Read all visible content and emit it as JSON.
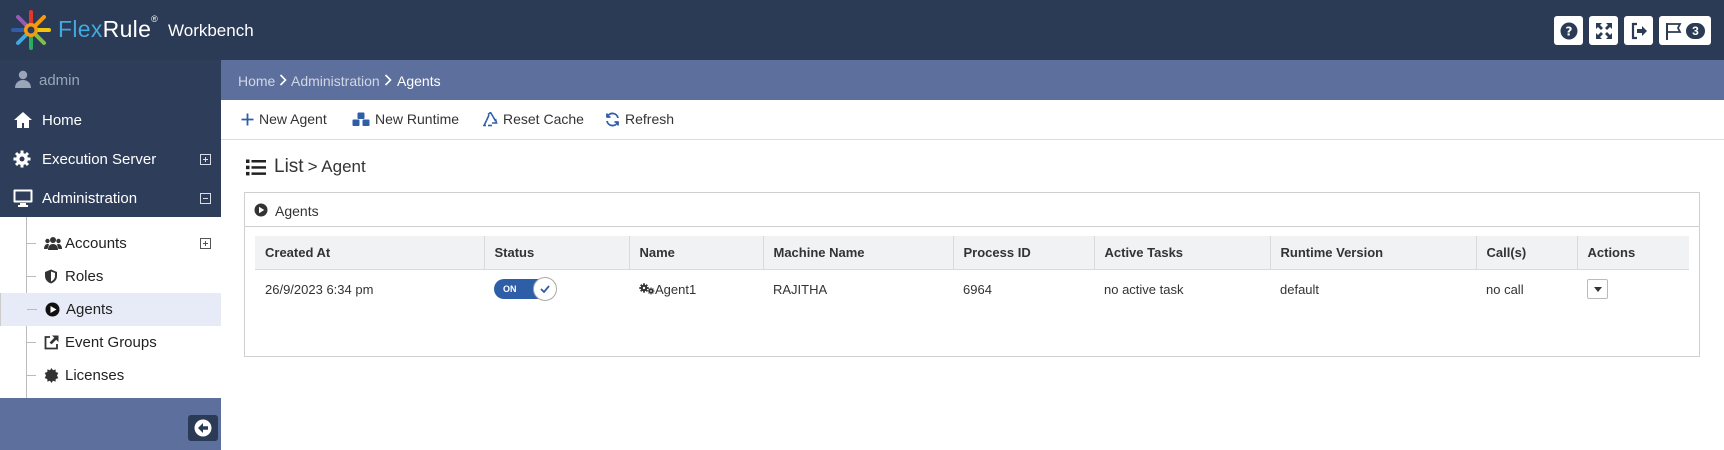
{
  "header": {
    "brand_flex": "Flex",
    "brand_rule": "Rule",
    "brand_mark": "®",
    "product": "Workbench",
    "flag_count": "3",
    "colors": {
      "bar": "#2b3a55",
      "brand_blue": "#3fa9e0"
    }
  },
  "sidebar": {
    "user": "admin",
    "items": [
      {
        "label": "Home",
        "icon": "home-icon"
      },
      {
        "label": "Execution Server",
        "icon": "gear-icon"
      },
      {
        "label": "Administration",
        "icon": "monitor-icon"
      }
    ],
    "sub_items": [
      {
        "label": "Accounts",
        "icon": "users-icon"
      },
      {
        "label": "Roles",
        "icon": "shield-icon"
      },
      {
        "label": "Agents",
        "icon": "play-circle-icon"
      },
      {
        "label": "Event Groups",
        "icon": "external-link-icon"
      },
      {
        "label": "Licenses",
        "icon": "certificate-icon"
      }
    ]
  },
  "breadcrumb": {
    "home": "Home",
    "admin": "Administration",
    "current": "Agents"
  },
  "toolbar": {
    "new_agent": "New Agent",
    "new_runtime": "New Runtime",
    "reset_cache": "Reset Cache",
    "refresh": "Refresh"
  },
  "page": {
    "title": "List",
    "subtitle": "> Agent"
  },
  "panel": {
    "title": "Agents"
  },
  "table": {
    "columns": [
      "Created At",
      "Status",
      "Name",
      "Machine Name",
      "Process ID",
      "Active Tasks",
      "Runtime Version",
      "Call(s)",
      "Actions"
    ],
    "rows": [
      {
        "created_at": "26/9/2023 6:34 pm",
        "status": "ON",
        "name": "Agent1",
        "machine": "RAJITHA",
        "pid": "6964",
        "tasks": "no active task",
        "runtime": "default",
        "calls": "no call"
      }
    ]
  }
}
